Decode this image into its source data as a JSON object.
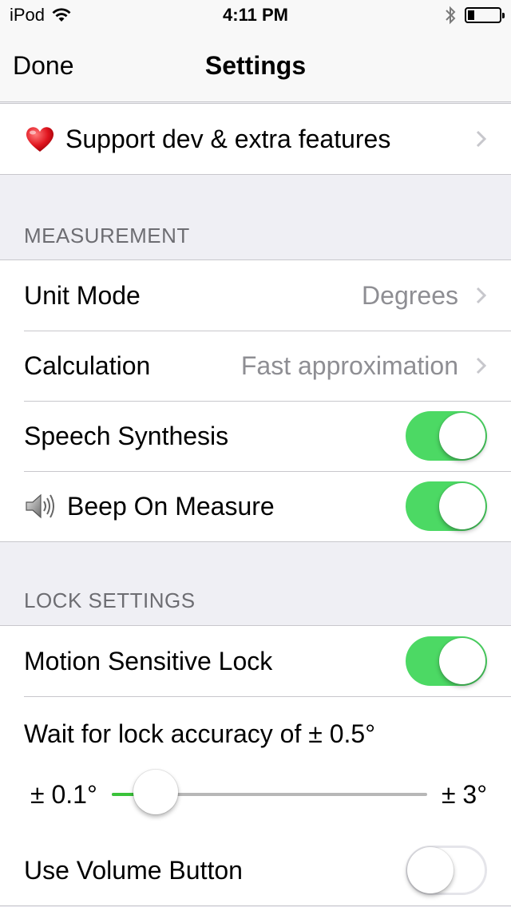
{
  "status_bar": {
    "carrier": "iPod",
    "time": "4:11 PM",
    "wifi_icon": "wifi-icon",
    "bluetooth_icon": "bluetooth-icon",
    "battery_icon": "battery-icon",
    "battery_level": 0.2
  },
  "nav": {
    "done_label": "Done",
    "title": "Settings"
  },
  "support": {
    "icon": "heart-icon",
    "label": "Support dev & extra features"
  },
  "measurement": {
    "header": "MEASUREMENT",
    "unit_mode_label": "Unit Mode",
    "unit_mode_value": "Degrees",
    "calculation_label": "Calculation",
    "calculation_value": "Fast approximation",
    "speech_label": "Speech Synthesis",
    "speech_on": true,
    "beep_icon": "speaker-icon",
    "beep_label": "Beep On Measure",
    "beep_on": true
  },
  "lock": {
    "header": "LOCK SETTINGS",
    "motion_label": "Motion Sensitive Lock",
    "motion_on": true,
    "wait_label": "Wait for lock accuracy of ± 0.5°",
    "slider_min_label": "± 0.1°",
    "slider_max_label": "± 3°",
    "slider_fraction": 0.14,
    "volume_label": "Use Volume Button",
    "volume_on": false
  },
  "colors": {
    "toggle_on": "#4cd964",
    "slider_fill": "#3ac33a",
    "secondary_text": "#8e8e93",
    "section_bg": "#efeff4"
  }
}
